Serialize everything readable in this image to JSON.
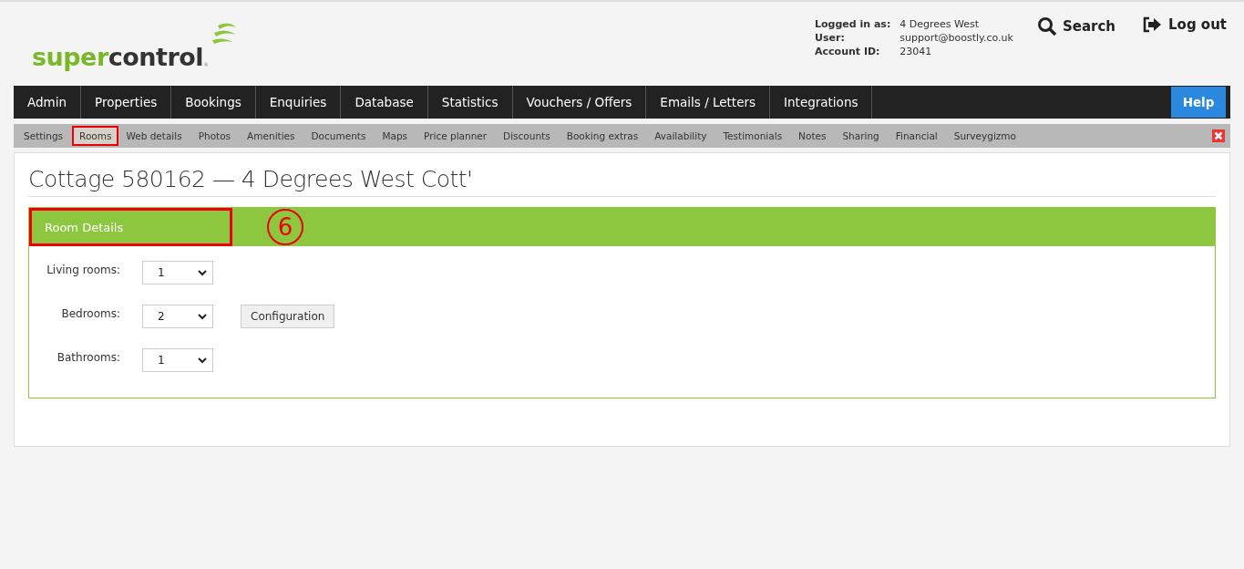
{
  "logo": {
    "part_1": "super",
    "part_2": "control",
    "mark": "®"
  },
  "account": [
    {
      "label": "Logged in as:",
      "value": "4 Degrees West"
    },
    {
      "label": "User:",
      "value": "support@boostly.co.uk"
    },
    {
      "label": "Account ID:",
      "value": "23041"
    }
  ],
  "header_actions": [
    {
      "kind": "search",
      "label": "Search"
    },
    {
      "kind": "logout",
      "label": "Log out"
    }
  ],
  "nav": [
    "Admin",
    "Properties",
    "Bookings",
    "Enquiries",
    "Database",
    "Statistics",
    "Vouchers / Offers",
    "Emails / Letters",
    "Integrations"
  ],
  "help": "Help",
  "subnav": [
    {
      "label": "Settings",
      "selected": false,
      "highlighted": false
    },
    {
      "label": "Rooms",
      "selected": true,
      "highlighted": true
    },
    {
      "label": "Web details",
      "selected": false,
      "highlighted": false
    },
    {
      "label": "Photos",
      "selected": false,
      "highlighted": false
    },
    {
      "label": "Amenities",
      "selected": false,
      "highlighted": false
    },
    {
      "label": "Documents",
      "selected": false,
      "highlighted": false
    },
    {
      "label": "Maps",
      "selected": false,
      "highlighted": false
    },
    {
      "label": "Price planner",
      "selected": false,
      "highlighted": false
    },
    {
      "label": "Discounts",
      "selected": false,
      "highlighted": false
    },
    {
      "label": "Booking extras",
      "selected": false,
      "highlighted": false
    },
    {
      "label": "Availability",
      "selected": false,
      "highlighted": false
    },
    {
      "label": "Testimonials",
      "selected": false,
      "highlighted": false
    },
    {
      "label": "Notes",
      "selected": false,
      "highlighted": false
    },
    {
      "label": "Sharing",
      "selected": false,
      "highlighted": false
    },
    {
      "label": "Financial",
      "selected": false,
      "highlighted": false
    },
    {
      "label": "Surveygizmo",
      "selected": false,
      "highlighted": false
    }
  ],
  "page_title": "Cottage 580162 — 4 Degrees West Cott'",
  "section": {
    "title": "Room Details",
    "highlighted": true,
    "callout": "6",
    "fields": [
      {
        "label": "Living rooms:",
        "value": "1"
      },
      {
        "label": "Bedrooms:",
        "value": "2",
        "button": "Configuration"
      },
      {
        "label": "Bathrooms:",
        "value": "1"
      }
    ]
  }
}
